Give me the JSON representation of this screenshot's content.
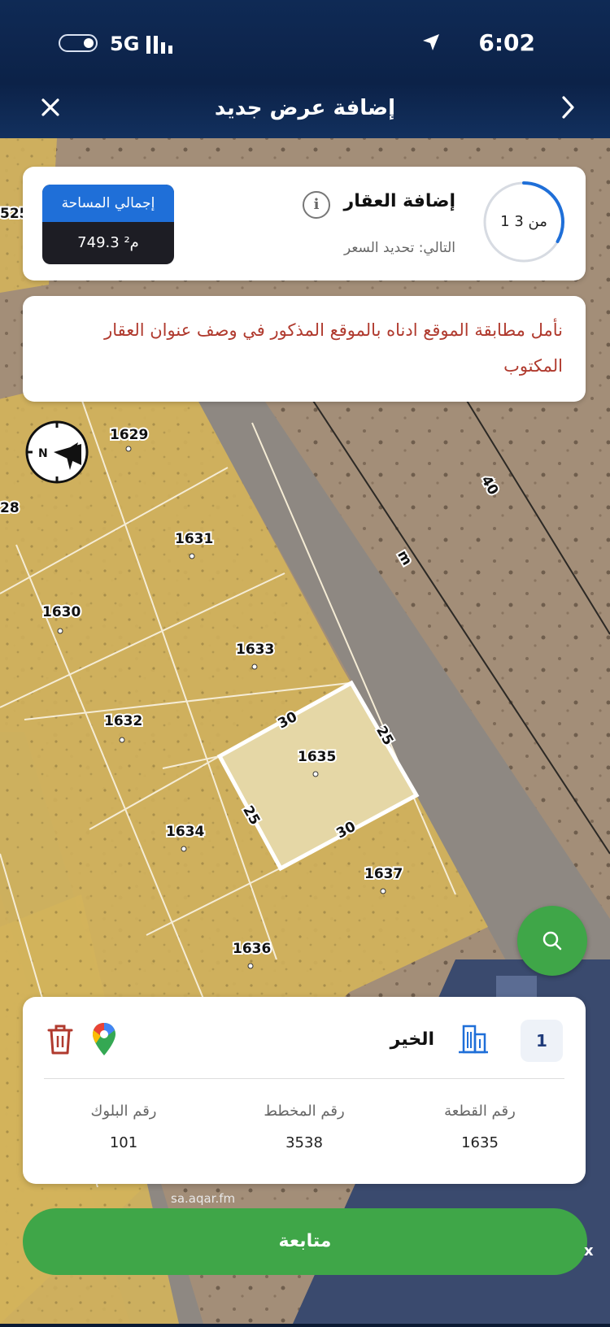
{
  "status_bar": {
    "time": "6:02",
    "network": "5G"
  },
  "header": {
    "title": "إضافة عرض جديد"
  },
  "progress": {
    "step_text": "1 من 3",
    "step_fraction": 0.333,
    "title": "إضافة العقار",
    "next": "التالي: تحديد السعر",
    "area_label": "إجمالي المساحة",
    "area_value": "749.3 م²"
  },
  "note": {
    "text": "نأمل مطابقة الموقع ادناه بالموقع المذكور في وصف عنوان العقار المكتوب"
  },
  "map": {
    "plot_labels": [
      "1629",
      "1631",
      "1630",
      "1633",
      "1632",
      "1635",
      "1634",
      "1637",
      "1636",
      "525",
      "28"
    ],
    "street_labels": [
      "40",
      "m"
    ],
    "dimensions": [
      "30",
      "25",
      "25",
      "30"
    ]
  },
  "details": {
    "index": "1",
    "district": "الخير",
    "plot_label": "رقم القطعة",
    "plot_value": "1635",
    "plan_label": "رقم المخطط",
    "plan_value": "3538",
    "block_label": "رقم البلوك",
    "block_value": "101"
  },
  "watermark": "sa.aqar.fm",
  "continue_label": "متابعة",
  "ad_close": "x",
  "colors": {
    "accent_green": "#3fa648",
    "accent_blue": "#1f6fd8",
    "note_red": "#b03a2e",
    "plot_fill": "#d4b45c"
  }
}
